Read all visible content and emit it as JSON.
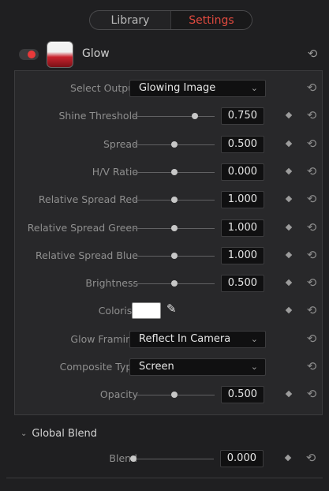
{
  "tabs": {
    "library": "Library",
    "settings": "Settings"
  },
  "effect": {
    "title": "Glow",
    "reset_icon": "⟲"
  },
  "icons": {
    "reset": "⟲",
    "chevron": "⌄",
    "eyedropper": "✎",
    "section_arrow": "⌄"
  },
  "colors": {
    "accent": "#e04a3f",
    "toggle_on": "#e8393a",
    "colorise": "#ffffff"
  },
  "params": {
    "select_output": {
      "label": "Select Output",
      "value": "Glowing Image"
    },
    "shine_threshold": {
      "label": "Shine Threshold",
      "value": "0.750"
    },
    "spread": {
      "label": "Spread",
      "value": "0.500"
    },
    "hv_ratio": {
      "label": "H/V Ratio",
      "value": "0.000"
    },
    "rel_red": {
      "label": "Relative Spread Red",
      "value": "1.000"
    },
    "rel_green": {
      "label": "Relative Spread Green",
      "value": "1.000"
    },
    "rel_blue": {
      "label": "Relative Spread Blue",
      "value": "1.000"
    },
    "brightness": {
      "label": "Brightness",
      "value": "0.500"
    },
    "colorise": {
      "label": "Colorise"
    },
    "glow_framing": {
      "label": "Glow Framing",
      "value": "Reflect In Camera"
    },
    "composite_type": {
      "label": "Composite Type",
      "value": "Screen"
    },
    "opacity": {
      "label": "Opacity",
      "value": "0.500"
    }
  },
  "global_blend": {
    "title": "Global Blend",
    "blend": {
      "label": "Blend",
      "value": "0.000"
    }
  }
}
